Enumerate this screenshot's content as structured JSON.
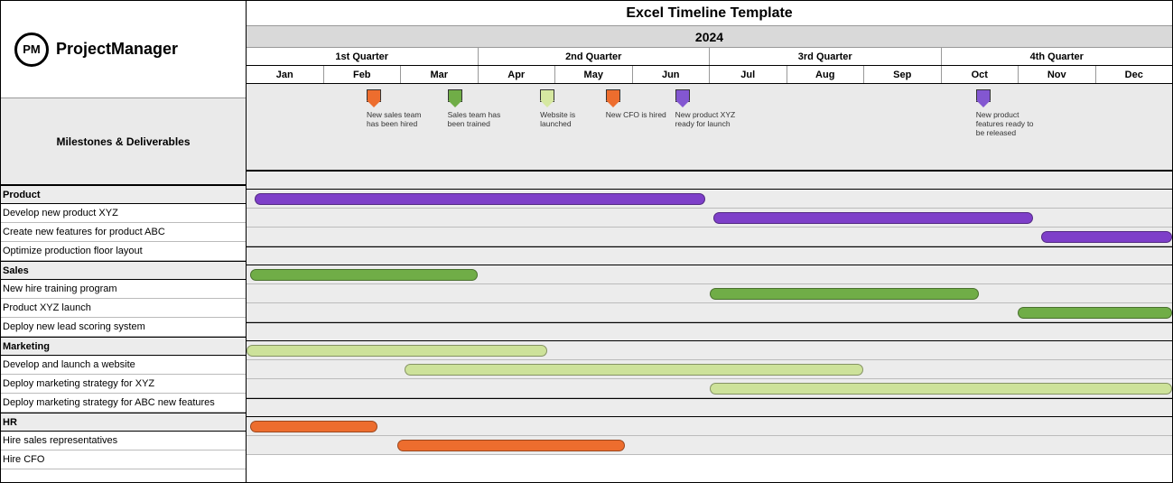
{
  "logo": {
    "badge": "PM",
    "name": "ProjectManager"
  },
  "title": "Excel Timeline Template",
  "year": "2024",
  "quarters": [
    "1st Quarter",
    "2nd Quarter",
    "3rd Quarter",
    "4th Quarter"
  ],
  "months": [
    "Jan",
    "Feb",
    "Mar",
    "Apr",
    "May",
    "Jun",
    "Jul",
    "Aug",
    "Sep",
    "Oct",
    "Nov",
    "Dec"
  ],
  "mile_header": "Milestones & Deliverables",
  "milestones": [
    {
      "month_pos": 1.65,
      "color": "#ed6d2e",
      "label": "New sales team has been hired"
    },
    {
      "month_pos": 2.7,
      "color": "#70ad47",
      "label": "Sales team has been trained"
    },
    {
      "month_pos": 3.9,
      "color": "#d6e8a1",
      "label": "Website is launched"
    },
    {
      "month_pos": 4.75,
      "color": "#ed6d2e",
      "label": "New CFO is hired"
    },
    {
      "month_pos": 5.65,
      "color": "#8357d1",
      "label": "New product XYZ ready for launch"
    },
    {
      "month_pos": 9.55,
      "color": "#8357d1",
      "label": "New  product features ready to be released"
    }
  ],
  "colors": {
    "purple": "#7e3fc9",
    "green": "#70ad47",
    "lightgreen": "#cde29a",
    "orange": "#ed6d2e"
  },
  "groups": [
    {
      "name": "Product",
      "rows": [
        {
          "label": "Develop new product XYZ",
          "start": 0.1,
          "end": 5.95,
          "color": "purple"
        },
        {
          "label": "Create new features for product ABC",
          "start": 6.05,
          "end": 10.2,
          "color": "purple"
        },
        {
          "label": "Optimize production floor layout",
          "start": 10.3,
          "end": 12.0,
          "color": "purple"
        }
      ]
    },
    {
      "name": "Sales",
      "rows": [
        {
          "label": "New hire training program",
          "start": 0.05,
          "end": 3.0,
          "color": "green"
        },
        {
          "label": "Product XYZ launch",
          "start": 6.0,
          "end": 9.5,
          "color": "green"
        },
        {
          "label": "Deploy new lead scoring system",
          "start": 10.0,
          "end": 12.0,
          "color": "green"
        }
      ]
    },
    {
      "name": "Marketing",
      "rows": [
        {
          "label": "Develop and launch a website",
          "start": 0.0,
          "end": 3.9,
          "color": "lightgreen"
        },
        {
          "label": "Deploy marketing strategy for XYZ",
          "start": 2.05,
          "end": 8.0,
          "color": "lightgreen"
        },
        {
          "label": "Deploy marketing strategy for ABC new features",
          "start": 6.0,
          "end": 12.0,
          "color": "lightgreen"
        }
      ]
    },
    {
      "name": "HR",
      "rows": [
        {
          "label": "Hire sales representatives",
          "start": 0.05,
          "end": 1.7,
          "color": "orange"
        },
        {
          "label": "Hire CFO",
          "start": 1.95,
          "end": 4.9,
          "color": "orange"
        }
      ]
    }
  ],
  "chart_data": {
    "type": "bar",
    "title": "Excel Timeline Template",
    "year": 2024,
    "time_axis": {
      "unit": "month",
      "start": 1,
      "end": 12,
      "labels": [
        "Jan",
        "Feb",
        "Mar",
        "Apr",
        "May",
        "Jun",
        "Jul",
        "Aug",
        "Sep",
        "Oct",
        "Nov",
        "Dec"
      ]
    },
    "milestones": [
      {
        "label": "New sales team has been hired",
        "month": 2.65,
        "category_color": "orange"
      },
      {
        "label": "Sales team has been trained",
        "month": 3.7,
        "category_color": "green"
      },
      {
        "label": "Website is launched",
        "month": 4.9,
        "category_color": "lightgreen"
      },
      {
        "label": "New CFO is hired",
        "month": 5.75,
        "category_color": "orange"
      },
      {
        "label": "New product XYZ ready for launch",
        "month": 6.65,
        "category_color": "purple"
      },
      {
        "label": "New product features ready to be released",
        "month": 10.55,
        "category_color": "purple"
      }
    ],
    "series": [
      {
        "group": "Product",
        "name": "Develop new product XYZ",
        "start_month": 1.1,
        "end_month": 6.95,
        "color": "purple"
      },
      {
        "group": "Product",
        "name": "Create new features for product ABC",
        "start_month": 7.05,
        "end_month": 11.2,
        "color": "purple"
      },
      {
        "group": "Product",
        "name": "Optimize production floor layout",
        "start_month": 11.3,
        "end_month": 13.0,
        "color": "purple"
      },
      {
        "group": "Sales",
        "name": "New hire training program",
        "start_month": 1.05,
        "end_month": 4.0,
        "color": "green"
      },
      {
        "group": "Sales",
        "name": "Product XYZ launch",
        "start_month": 7.0,
        "end_month": 10.5,
        "color": "green"
      },
      {
        "group": "Sales",
        "name": "Deploy new lead scoring system",
        "start_month": 11.0,
        "end_month": 13.0,
        "color": "green"
      },
      {
        "group": "Marketing",
        "name": "Develop and launch a website",
        "start_month": 1.0,
        "end_month": 4.9,
        "color": "lightgreen"
      },
      {
        "group": "Marketing",
        "name": "Deploy marketing strategy for XYZ",
        "start_month": 3.05,
        "end_month": 9.0,
        "color": "lightgreen"
      },
      {
        "group": "Marketing",
        "name": "Deploy marketing strategy for ABC new features",
        "start_month": 7.0,
        "end_month": 13.0,
        "color": "lightgreen"
      },
      {
        "group": "HR",
        "name": "Hire sales representatives",
        "start_month": 1.05,
        "end_month": 2.7,
        "color": "orange"
      },
      {
        "group": "HR",
        "name": "Hire CFO",
        "start_month": 2.95,
        "end_month": 5.9,
        "color": "orange"
      }
    ]
  }
}
